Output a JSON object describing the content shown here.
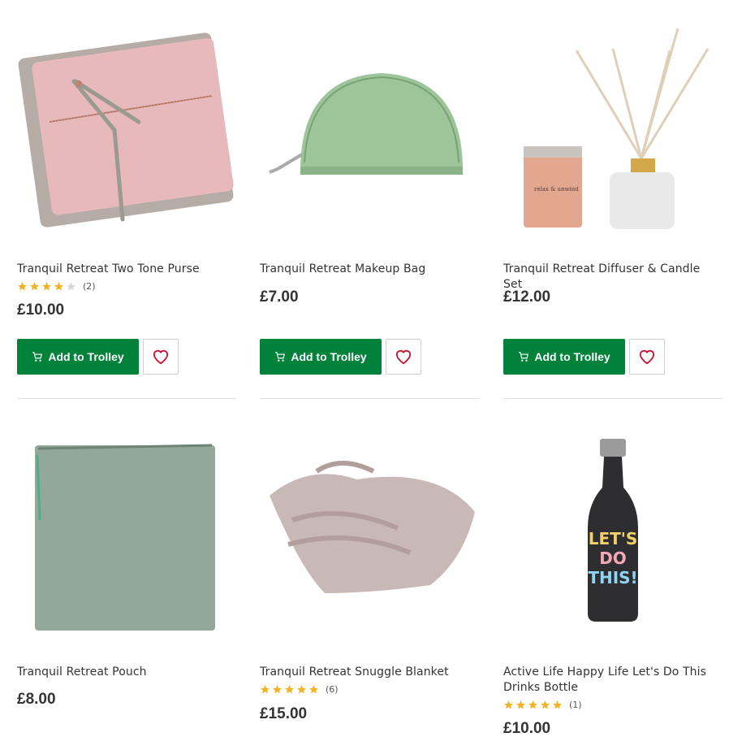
{
  "products": [
    {
      "title": "Tranquil Retreat Two Tone Purse",
      "rating": 4,
      "review_count": "(2)",
      "price": "£10.00",
      "add_label": "Add to Trolley"
    },
    {
      "title": "Tranquil Retreat Makeup Bag",
      "price": "£7.00",
      "add_label": "Add to Trolley"
    },
    {
      "title": "Tranquil Retreat Diffuser & Candle Set",
      "price": "£12.00",
      "add_label": "Add to Trolley"
    },
    {
      "title": "Tranquil Retreat Pouch",
      "price": "£8.00"
    },
    {
      "title": "Tranquil Retreat Snuggle Blanket",
      "rating": 5,
      "review_count": "(6)",
      "price": "£15.00"
    },
    {
      "title_line1": "Active Life Happy Life Let's Do This",
      "title_line2": "Drinks Bottle",
      "rating": 5,
      "review_count": "(1)",
      "price": "£10.00"
    }
  ],
  "bottle_text": [
    "LET'S",
    "DO",
    "THIS!"
  ],
  "candle_text": "relax & unwind",
  "colors": {
    "accent": "#00823a",
    "star": "#f0b323",
    "star_empty": "#d8d8d8",
    "heart": "#c8102e"
  }
}
